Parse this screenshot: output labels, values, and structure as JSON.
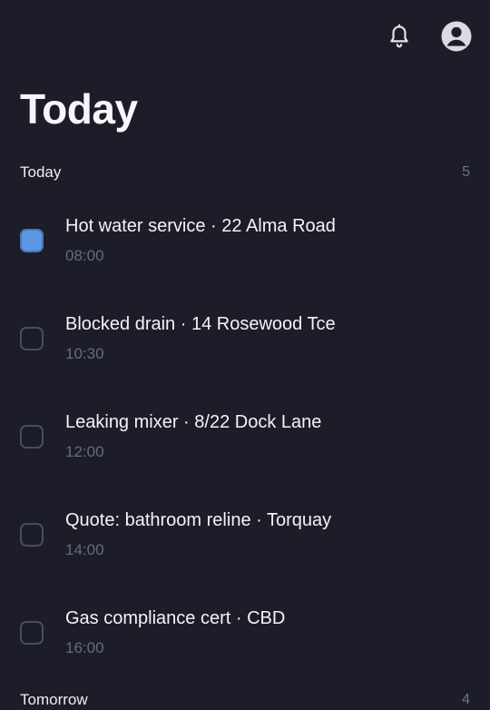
{
  "header": {
    "notifications_icon": "bell-icon",
    "account_icon": "account-circle-icon"
  },
  "page": {
    "title": "Today"
  },
  "sections": [
    {
      "title": "Today",
      "count": "5",
      "tasks": [
        {
          "title": "Hot water service · 22 Alma Road",
          "time": "08:00",
          "checked": true
        },
        {
          "title": "Blocked drain · 14 Rosewood Tce",
          "time": "10:30",
          "checked": false
        },
        {
          "title": "Leaking mixer · 8/22 Dock Lane",
          "time": "12:00",
          "checked": false
        },
        {
          "title": "Quote: bathroom reline · Torquay",
          "time": "14:00",
          "checked": false
        },
        {
          "title": "Gas compliance cert · CBD",
          "time": "16:00",
          "checked": false
        }
      ]
    },
    {
      "title": "Tomorrow",
      "count": "4"
    }
  ],
  "colors": {
    "background": "#1c1d28",
    "checked_accent": "#5b98e4",
    "secondary_text": "#676b79"
  }
}
